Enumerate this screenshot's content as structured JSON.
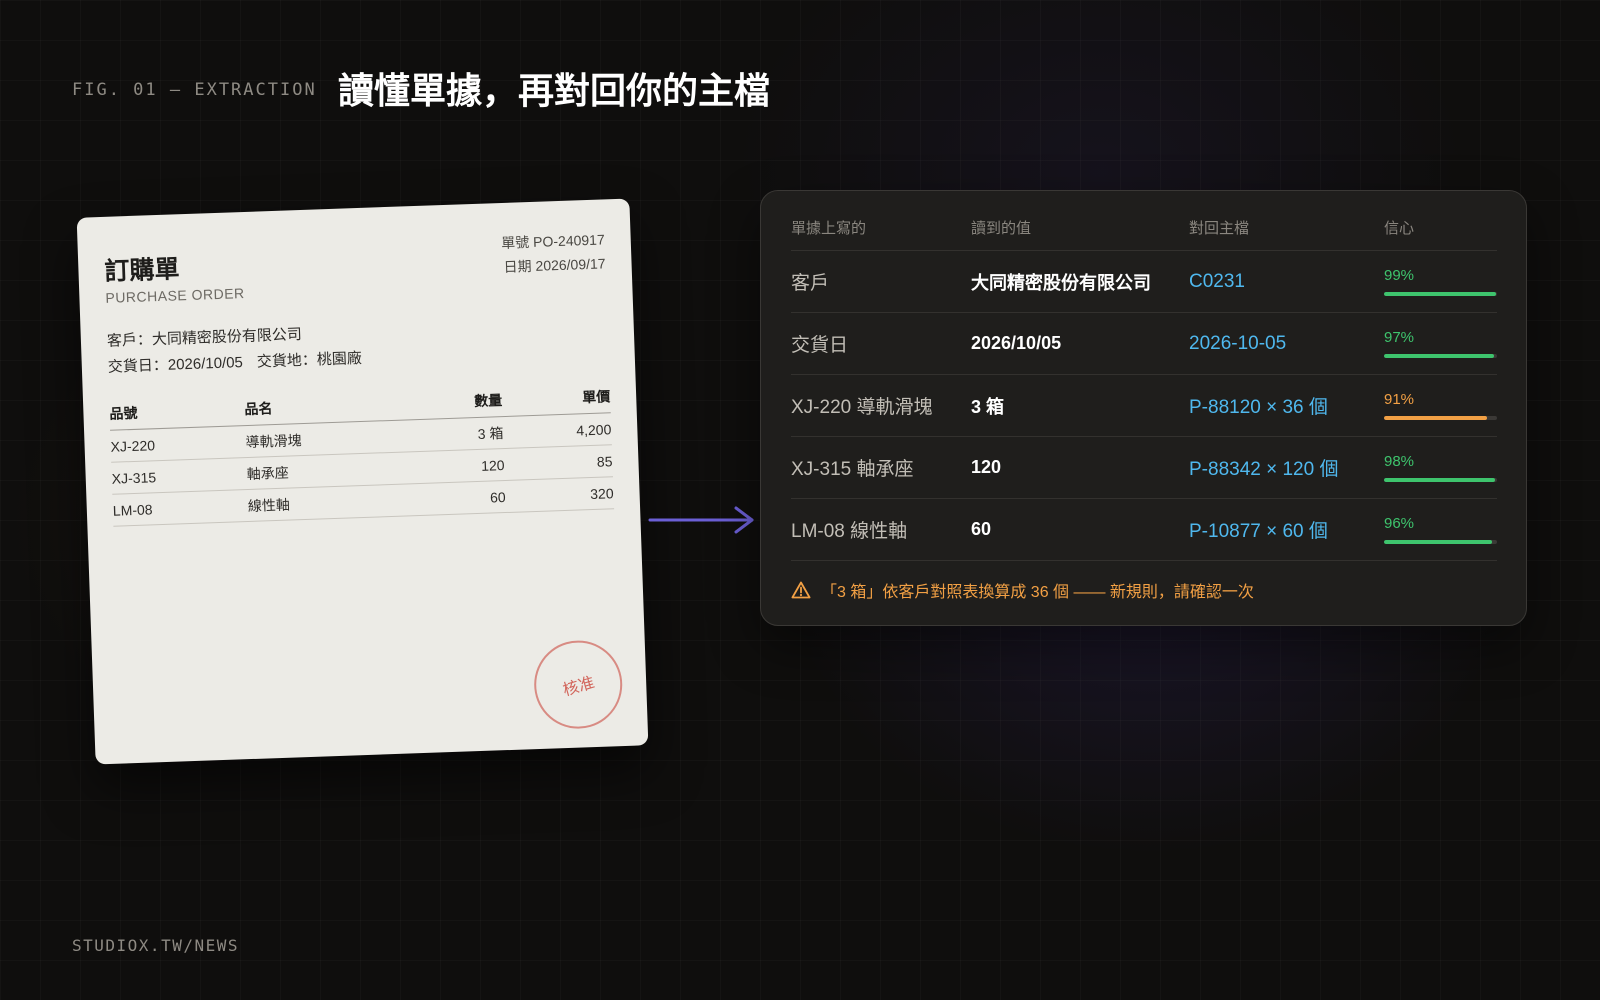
{
  "header": {
    "fig_label": "FIG. 01 — EXTRACTION",
    "title": "讀懂單據，再對回你的主檔"
  },
  "footer": {
    "site": "STUDIOX.TW/NEWS"
  },
  "document": {
    "title": "訂購單",
    "subtitle": "PURCHASE ORDER",
    "order_no": "單號 PO-240917",
    "date": "日期 2026/09/17",
    "customer": "客戶：大同精密股份有限公司",
    "delivery_date": "交貨日：2026/10/05",
    "delivery_place": "交貨地：桃園廠",
    "columns": [
      "品號",
      "品名",
      "數量",
      "單價"
    ],
    "items": [
      {
        "code": "XJ-220",
        "name": "導軌滑塊",
        "qty": "3 箱",
        "price": "4,200"
      },
      {
        "code": "XJ-315",
        "name": "軸承座",
        "qty": "120",
        "price": "85"
      },
      {
        "code": "LM-08",
        "name": "線性軸",
        "qty": "60",
        "price": "320"
      }
    ],
    "stamp": "核准"
  },
  "extraction": {
    "columns": [
      "單據上寫的",
      "讀到的值",
      "對回主檔",
      "信心"
    ],
    "rows": [
      {
        "source": "客戶",
        "value": "大同精密股份有限公司",
        "match": "C0231",
        "confidence_label": "99%",
        "confidence": 0.99,
        "color": "#3ec46d"
      },
      {
        "source": "交貨日",
        "value": "2026/10/05",
        "match": "2026-10-05",
        "confidence_label": "97%",
        "confidence": 0.97,
        "color": "#3ec46d"
      },
      {
        "source": "XJ-220 導軌滑塊",
        "value": "3 箱",
        "match": "P-88120 × 36 個",
        "confidence_label": "91%",
        "confidence": 0.91,
        "color": "#f2a044"
      },
      {
        "source": "XJ-315 軸承座",
        "value": "120",
        "match": "P-88342 × 120 個",
        "confidence_label": "98%",
        "confidence": 0.98,
        "color": "#3ec46d"
      },
      {
        "source": "LM-08 線性軸",
        "value": "60",
        "match": "P-10877 × 60 個",
        "confidence_label": "96%",
        "confidence": 0.96,
        "color": "#3ec46d"
      }
    ],
    "warning": "「3 箱」依客戶對照表換算成 36 個 —— 新規則，請確認一次"
  },
  "colors": {
    "accent_arrow": "#6b5fd6",
    "link": "#4fb8ee",
    "ok": "#3ec46d",
    "warn": "#f2a044",
    "stamp": "#d2665c"
  },
  "icons": {
    "arrow": "arrow-right-icon",
    "warning": "warning-triangle-icon",
    "stamp": "approval-stamp-icon"
  }
}
